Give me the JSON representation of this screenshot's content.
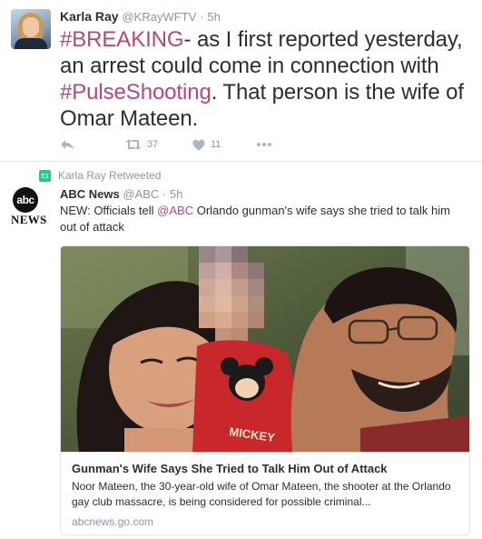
{
  "tweet1": {
    "author_name": "Karla Ray",
    "author_handle": "@KRayWFTV",
    "time": "5h",
    "text": {
      "hashtag1": "#BREAKING",
      "part1": "- as I first reported yesterday, an arrest could come in connection with ",
      "hashtag2": "#PulseShooting",
      "part2": ".  That person is the wife of Omar Mateen."
    },
    "actions": {
      "retweet_count": "37",
      "like_count": "11"
    }
  },
  "retweet_label": "Karla Ray Retweeted",
  "tweet2": {
    "avatar_logo_text": "abc",
    "avatar_wordmark": "NEWS",
    "author_name": "ABC News",
    "author_handle": "@ABC",
    "time": "5h",
    "text": {
      "part1": "NEW: Officials tell ",
      "mention": "@ABC",
      "part2": " Orlando gunman's wife says she tried to talk him out of attack"
    },
    "card": {
      "title": "Gunman's Wife Says She Tried to Talk Him Out of Attack",
      "description": "Noor Mateen, the 30-year-old wife of Omar Mateen, the shooter at the Orlando gay club massacre, is being considered for possible criminal...",
      "domain": "abcnews.go.com",
      "shirt_text": "MICKEY"
    }
  },
  "colors": {
    "hashtag": "#b3487e",
    "meta_gray": "#8899a6",
    "icon_gray": "#aab8c2",
    "retweet_green": "#19cf86",
    "border": "#e1e8ed"
  }
}
